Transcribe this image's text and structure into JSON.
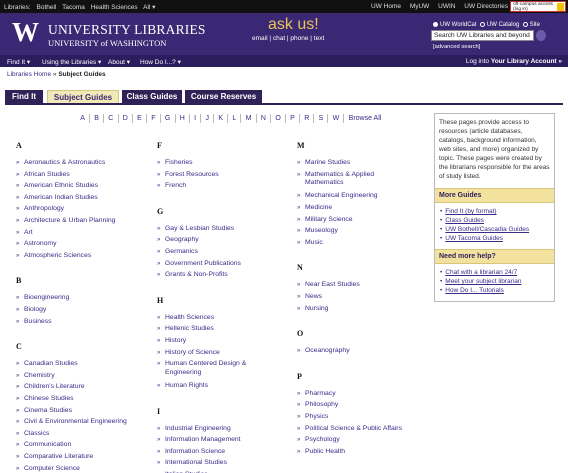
{
  "topbar": {
    "label": "Libraries:",
    "links": [
      "Bothell",
      "Tacoma",
      "Health Sciences",
      "All ▾"
    ],
    "right_links": [
      "UW Home",
      "MyUW",
      "UWIN",
      "UW Directories"
    ],
    "offcampus": "off-campus access",
    "offcampus_sub": "(log in)"
  },
  "header": {
    "logo": "W",
    "title": "UNIVERSITY LIBRARIES",
    "subtitle": "UNIVERSITY of WASHINGTON",
    "askus": "ask us!",
    "asklinks": "email | chat | phone | text",
    "search_options": [
      "UW WorldCat",
      "UW Catalog",
      "Site"
    ],
    "search_value": "Search UW Libraries and beyond",
    "advanced": "[advanced search]"
  },
  "navbar": {
    "items": [
      "Find It ▾",
      "Using the Libraries ▾",
      "About ▾",
      "How Do I...? ▾"
    ],
    "login_prefix": "Log into",
    "login": "Your Library Account »"
  },
  "breadcrumb": {
    "home": "Libraries Home",
    "sep": "»",
    "current": "Subject Guides"
  },
  "tabs": [
    "Find It",
    "Subject Guides",
    "Class Guides",
    "Course Reserves"
  ],
  "alpha": [
    "A",
    "B",
    "C",
    "D",
    "E",
    "F",
    "G",
    "H",
    "I",
    "J",
    "K",
    "L",
    "M",
    "N",
    "O",
    "P",
    "R",
    "S",
    "W",
    "Browse All"
  ],
  "sidebar": {
    "intro": "These pages provide access to resources (article databases, catalogs, background information, web sites, and more) organized by topic. These pages were created by the librarians responsible for the areas of study listed.",
    "more_title": "More Guides",
    "more": [
      "Find It (by format)",
      "Class Guides",
      "UW Bothell/Cascadia Guides",
      "UW Tacoma Guides"
    ],
    "help_title": "Need more help?",
    "help": [
      "Chat with a librarian 24/7",
      "Meet your subject librarian",
      "How Do I... Tutorials"
    ]
  },
  "columns": [
    [
      {
        "letter": "A",
        "items": [
          "Aeronautics & Astronautics",
          "African Studies",
          "American Ethnic Studies",
          "American Indian Studies",
          "Anthropology",
          "Architecture & Urban Planning",
          "Art",
          "Astronomy",
          "Atmospheric Sciences"
        ]
      },
      {
        "letter": "B",
        "items": [
          "Bioengineering",
          "Biology",
          "Business"
        ]
      },
      {
        "letter": "C",
        "items": [
          "Canadian Studies",
          "Chemistry",
          "Children's Literature",
          "Chinese Studies",
          "Cinema Studies",
          "Civil & Environmental Engineering",
          "Classics",
          "Communication",
          "Comparative Literature",
          "Computer Science"
        ]
      }
    ],
    [
      {
        "letter": "F",
        "items": [
          "Fisheries",
          "Forest Resources",
          "French"
        ]
      },
      {
        "letter": "G",
        "items": [
          "Gay & Lesbian Studies",
          "Geography",
          "Germanics",
          "Government Publications",
          "Grants & Non-Profits"
        ]
      },
      {
        "letter": "H",
        "items": [
          "Health Sciences",
          "Hellenic Studies",
          "History",
          "History of Science",
          "Human Centered Design & Engineering",
          "Human Rights"
        ]
      },
      {
        "letter": "I",
        "items": [
          "Industrial Engineering",
          "Information Management",
          "Information Science",
          "International Studies",
          "Italian Studies"
        ]
      }
    ],
    [
      {
        "letter": "M",
        "items": [
          "Marine Studies",
          "Mathematics & Applied Mathematics",
          "Mechanical Engineering",
          "Medicine",
          "Military Science",
          "Museology",
          "Music"
        ]
      },
      {
        "letter": "N",
        "items": [
          "Near East Studies",
          "News",
          "Nursing"
        ]
      },
      {
        "letter": "O",
        "items": [
          "Oceanography"
        ]
      },
      {
        "letter": "P",
        "items": [
          "Pharmacy",
          "Philosophy",
          "Physics",
          "Political Science & Public Affairs",
          "Psychology",
          "Public Health"
        ]
      },
      {
        "letter": "R",
        "items": []
      }
    ]
  ]
}
